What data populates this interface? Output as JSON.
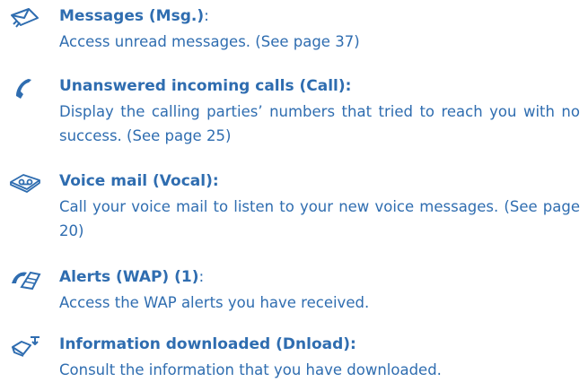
{
  "entries": [
    {
      "icon": "message-envelope-icon",
      "title": "Messages (Msg.)",
      "title_suffix": ":",
      "description": "Access unread messages. (See page 37)"
    },
    {
      "icon": "phone-handset-icon",
      "title": "Unanswered incoming calls (Call):",
      "title_suffix": "",
      "description": "Display the calling parties’ numbers that tried to reach you with no success. (See page 25)"
    },
    {
      "icon": "voice-mail-icon",
      "title": "Voice mail (Vocal):",
      "title_suffix": "",
      "description": "Call your voice mail to listen to your new voice messages. (See page 20)"
    },
    {
      "icon": "wap-alert-icon",
      "title": "Alerts (WAP) (1)",
      "title_suffix": ":",
      "description": "Access the WAP alerts you have received."
    },
    {
      "icon": "download-icon",
      "title": "Information downloaded (Dnload):",
      "title_suffix": "",
      "description": "Consult the information that you have downloaded."
    }
  ],
  "colors": {
    "text": "#2f6db0"
  }
}
